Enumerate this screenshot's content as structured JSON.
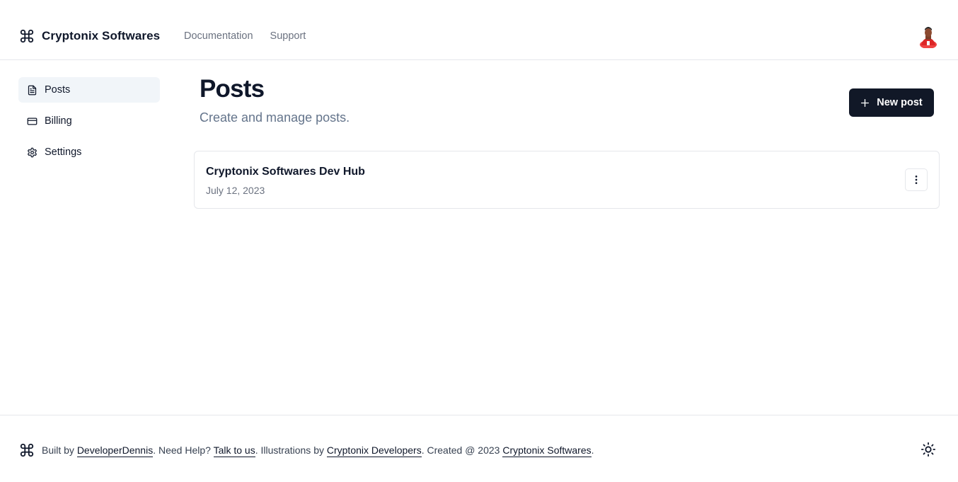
{
  "header": {
    "brand": "Cryptonix Softwares",
    "nav": [
      "Documentation",
      "Support"
    ]
  },
  "sidebar": {
    "items": [
      {
        "label": "Posts",
        "icon": "file-text-icon",
        "active": true
      },
      {
        "label": "Billing",
        "icon": "credit-card-icon"
      },
      {
        "label": "Settings",
        "icon": "gear-icon"
      }
    ]
  },
  "main": {
    "title": "Posts",
    "subtitle": "Create and manage posts.",
    "new_post_label": "New post",
    "posts": [
      {
        "title": "Cryptonix Softwares Dev Hub",
        "date": "July 12, 2023"
      }
    ]
  },
  "footer": {
    "built_by_prefix": "Built by ",
    "author": "DeveloperDennis",
    "help_prefix": ". Need Help? ",
    "help_link": "Talk to us",
    "illus_prefix": ". Illustrations by ",
    "illus_link": "Cryptonix Developers",
    "created_prefix": ". Created @ 2023 ",
    "company_link": "Cryptonix Softwares",
    "suffix": "."
  },
  "colors": {
    "primary": "#111827",
    "muted": "#6b7280",
    "border": "#e5e7eb",
    "active_bg": "#f1f5f9"
  }
}
